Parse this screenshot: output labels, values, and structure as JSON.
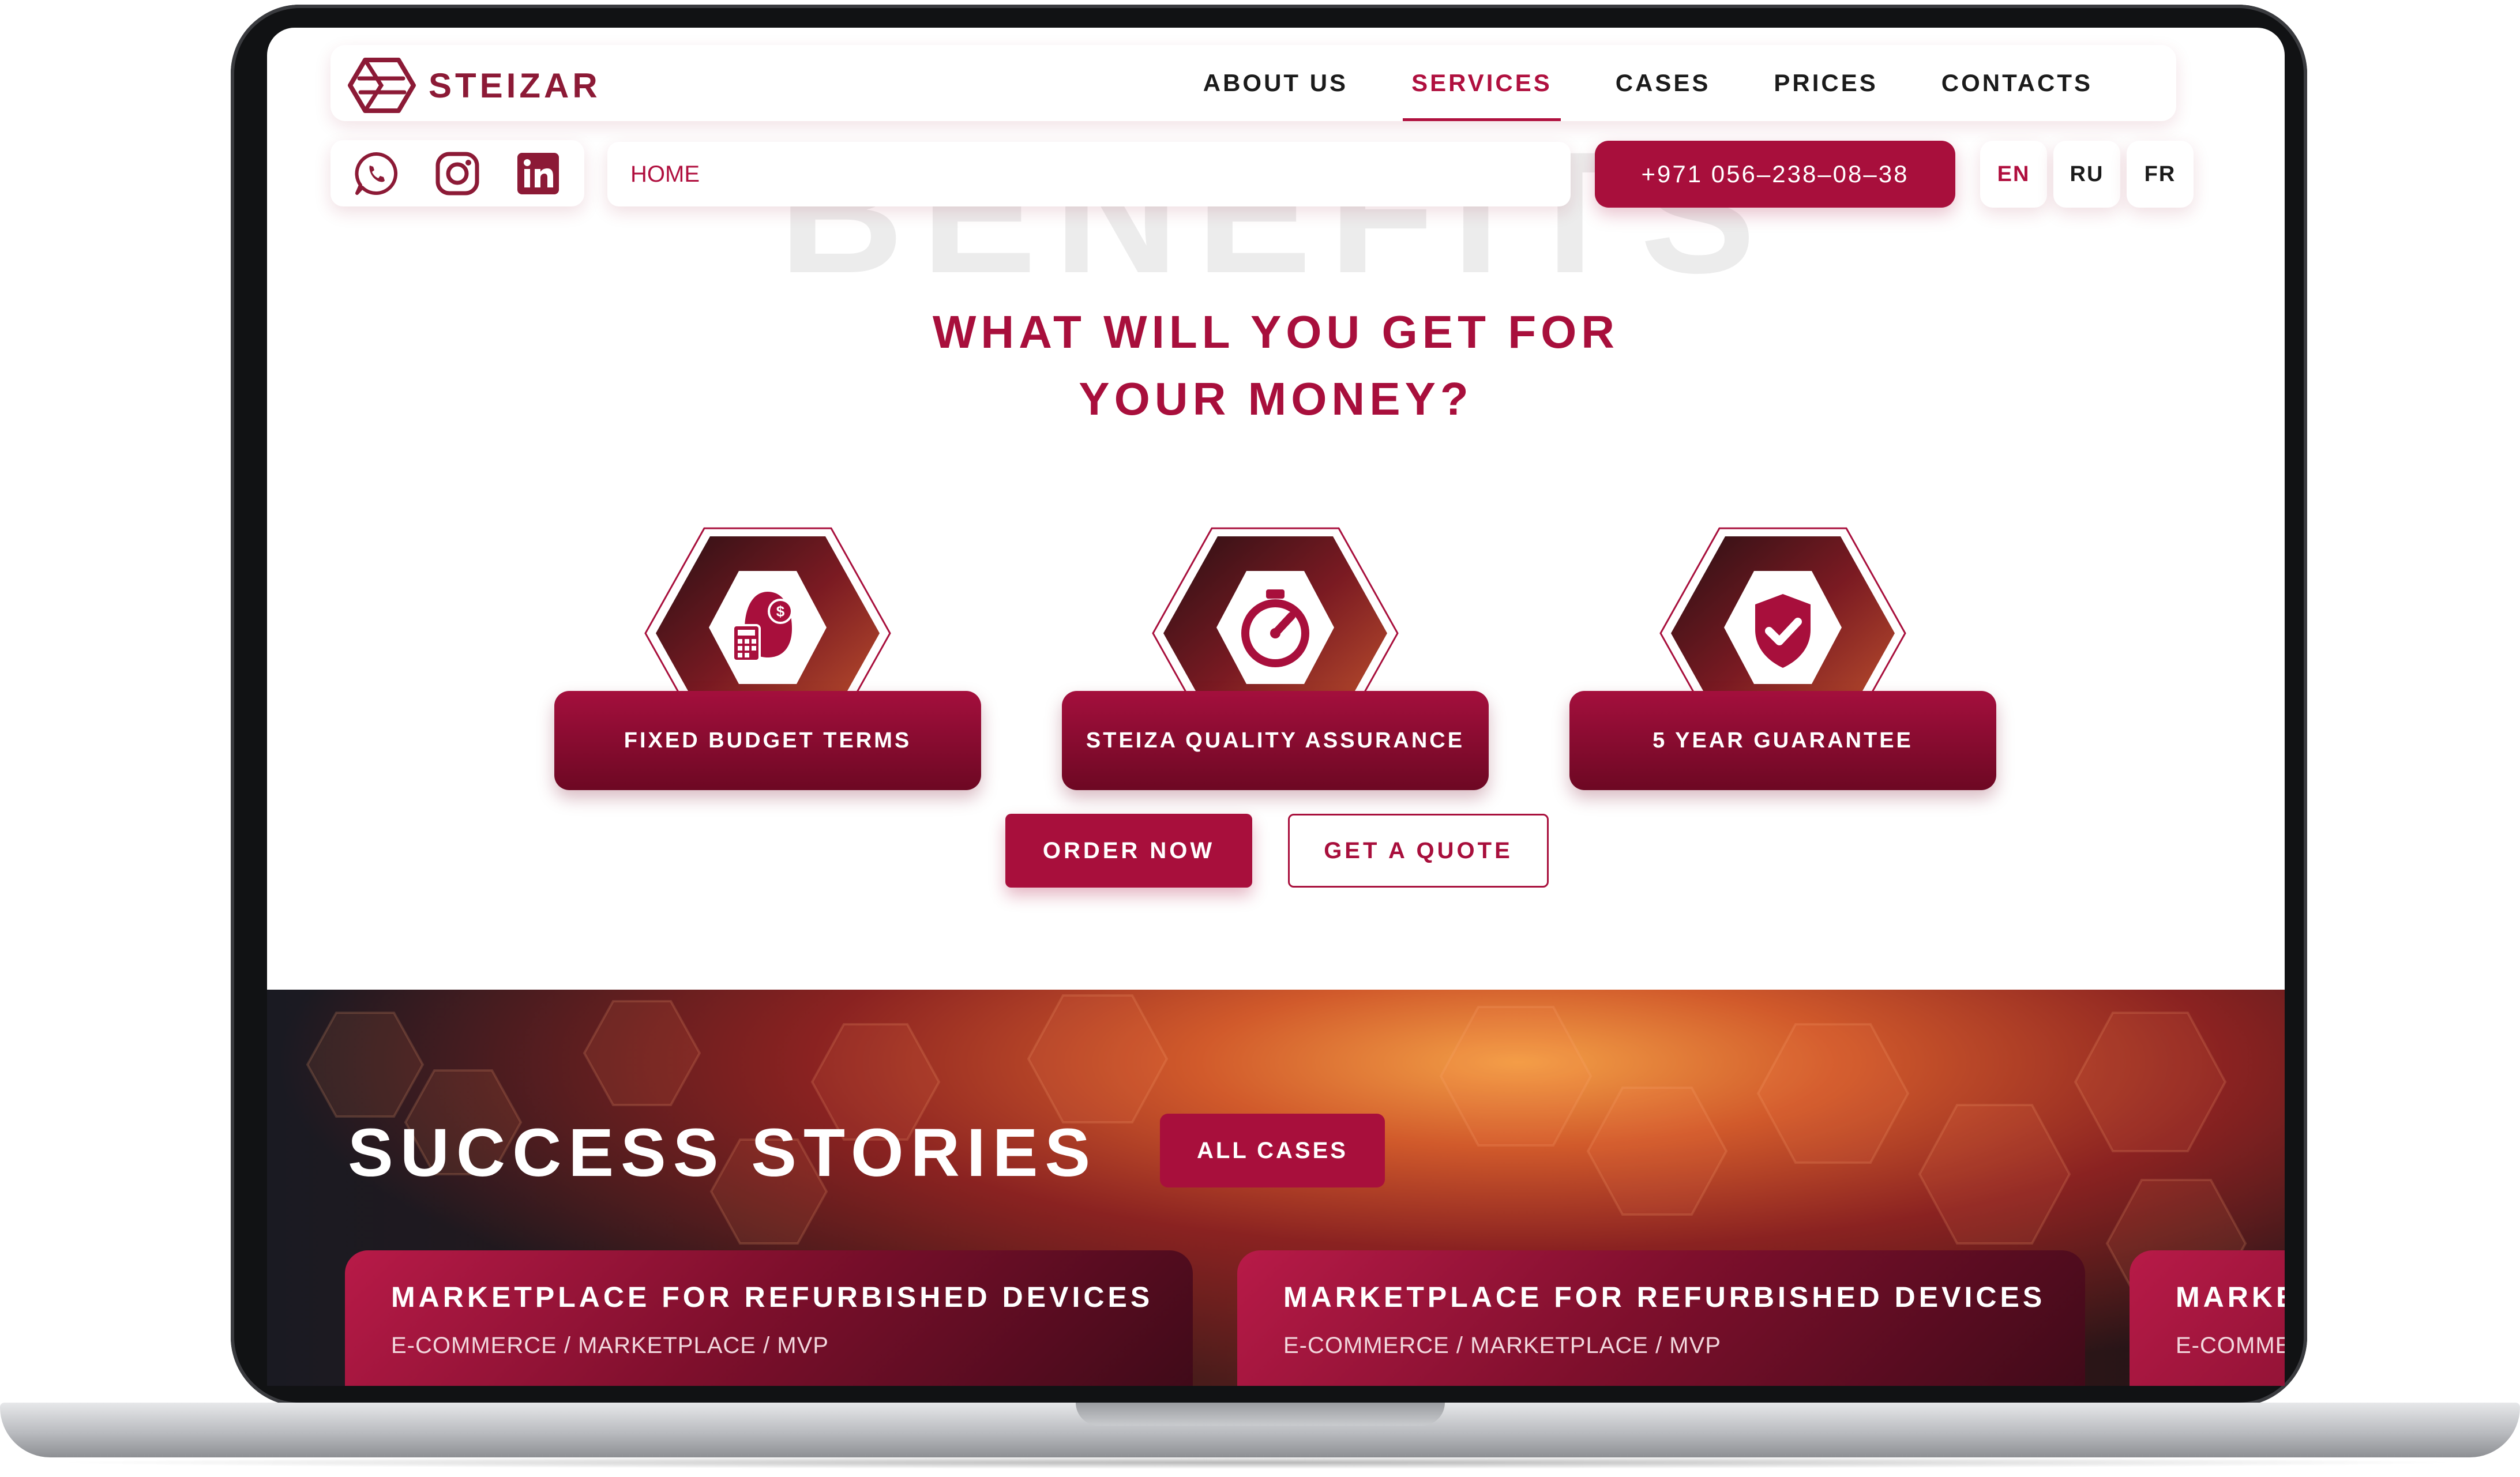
{
  "brand": {
    "name": "STEIZAR",
    "accent": "#a80f3c",
    "dark_accent": "#8c1a36"
  },
  "nav": {
    "items": [
      {
        "label": "ABOUT US",
        "active": false
      },
      {
        "label": "SERVICES",
        "active": true
      },
      {
        "label": "CASES",
        "active": false
      },
      {
        "label": "PRICES",
        "active": false
      },
      {
        "label": "CONTACTS",
        "active": false
      }
    ]
  },
  "social": {
    "icons": [
      "whatsapp-icon",
      "instagram-icon",
      "linkedin-icon"
    ]
  },
  "breadcrumb": {
    "text": "HOME"
  },
  "phone": {
    "label": "+971 056–238–08–38"
  },
  "languages": [
    {
      "label": "EN",
      "active": true
    },
    {
      "label": "RU",
      "active": false
    },
    {
      "label": "FR",
      "active": false
    }
  ],
  "benefits_section": {
    "background_word": "BENEFITS",
    "headline": "WHAT WILL YOU GET FOR\nYOUR MONEY?",
    "cards": [
      {
        "label": "FIXED BUDGET TERMS",
        "icon": "money-bag-calculator-icon"
      },
      {
        "label": "STEIZA QUALITY ASSURANCE",
        "icon": "stopwatch-icon"
      },
      {
        "label": "5 YEAR GUARANTEE",
        "icon": "shield-check-icon"
      }
    ],
    "order_button": "ORDER NOW",
    "quote_button": "GET A QUOTE"
  },
  "stories_section": {
    "title": "SUCCESS STORIES",
    "all_cases_button": "ALL CASES",
    "cases": [
      {
        "title": "MARKETPLACE FOR REFURBISHED DEVICES",
        "tags": "E-COMMERCE / MARKETPLACE / MVP"
      },
      {
        "title": "MARKETPLACE FOR REFURBISHED DEVICES",
        "tags": "E-COMMERCE / MARKETPLACE / MVP"
      },
      {
        "title": "MARKETPLACE FOR REFURBISHED DEVICES",
        "tags": "E-COMMERCE / MARKETPLACE / MVP"
      }
    ]
  }
}
